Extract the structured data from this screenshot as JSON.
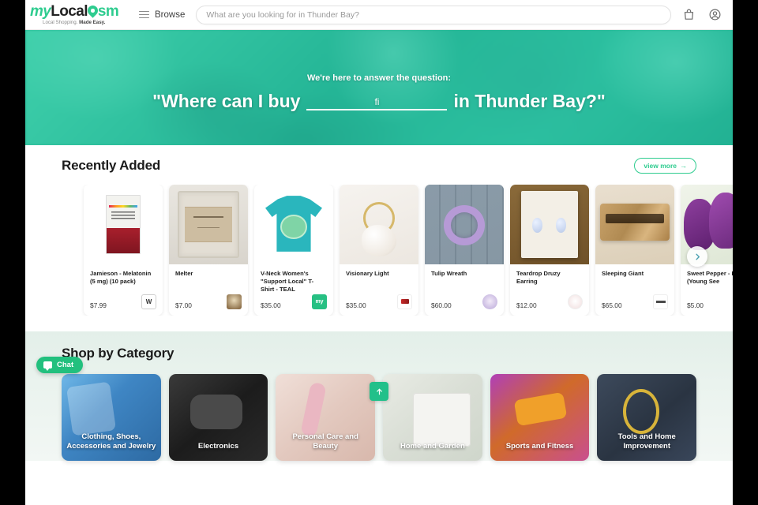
{
  "header": {
    "logo": {
      "prefix": "my",
      "main": "Local",
      "suffix": "sm",
      "pin_icon": "location-pin-icon",
      "tagline_1": "Local Shopping.",
      "tagline_2": "Made Easy."
    },
    "browse_label": "Browse",
    "menu_icon": "hamburger-menu-icon",
    "search": {
      "placeholder": "What are you looking for in Thunder Bay?",
      "value": "",
      "icon": "search-input"
    },
    "bag_icon": "shopping-bag-icon",
    "account_icon": "user-account-icon"
  },
  "hero": {
    "subtitle": "We're here to answer the question:",
    "title_before": "\"Where can I buy",
    "blank_text": "fi",
    "title_after": "in Thunder Bay?\""
  },
  "recently_added": {
    "title": "Recently Added",
    "view_more_label": "view more",
    "view_more_arrow": "→",
    "next_arrow_icon": "chevron-right-icon",
    "products": [
      {
        "name": "Jamieson - Melatonin (5 mg) (10 pack)",
        "price": "$7.99",
        "art": "art-melatonin",
        "badge": "b-wsd",
        "badge_text": "W",
        "badge_sub": "SD"
      },
      {
        "name": "Melter",
        "price": "$7.00",
        "art": "art-melter",
        "badge": "b-cat",
        "badge_text": "",
        "badge_sub": ""
      },
      {
        "name": "V-Neck Women's \"Support Local\" T-Shirt - TEAL",
        "price": "$35.00",
        "art": "art-tshirt",
        "badge": "b-my",
        "badge_text": "my",
        "badge_sub": ""
      },
      {
        "name": "Visionary Light",
        "price": "$35.00",
        "art": "art-visionary",
        "badge": "b-vis",
        "badge_text": "",
        "badge_sub": ""
      },
      {
        "name": "Tulip Wreath",
        "price": "$60.00",
        "art": "art-wreath",
        "badge": "b-tul",
        "badge_text": "",
        "badge_sub": ""
      },
      {
        "name": "Teardrop Druzy Earring",
        "price": "$12.00",
        "art": "art-druzy",
        "badge": "b-ear",
        "badge_text": "",
        "badge_sub": ""
      },
      {
        "name": "Sleeping Giant",
        "price": "$65.00",
        "art": "art-board",
        "badge": "b-slp",
        "badge_text": "",
        "badge_sub": ""
      },
      {
        "name": "Sweet Pepper - Bell (Young See",
        "price": "$5.00",
        "art": "art-pepper",
        "badge": "",
        "badge_text": "",
        "badge_sub": ""
      }
    ]
  },
  "categories": {
    "title": "Shop by Category",
    "items": [
      {
        "label": "Clothing, Shoes, Accessories and Jewelry",
        "bg": "cbg-clothing"
      },
      {
        "label": "Electronics",
        "bg": "cbg-electronics"
      },
      {
        "label": "Personal Care and Beauty",
        "bg": "cbg-personal"
      },
      {
        "label": "Home and Garden",
        "bg": "cbg-home"
      },
      {
        "label": "Sports and Fitness",
        "bg": "cbg-sports"
      },
      {
        "label": "Tools and Home Improvement",
        "bg": "cbg-tools"
      }
    ]
  },
  "floating": {
    "chat_label": "Chat",
    "chat_icon": "chat-bubble-icon",
    "scroll_top_icon": "arrow-up-icon"
  },
  "colors": {
    "brand_green": "#2ecc8f",
    "hero_teal": "#28b894",
    "chat_green": "#22c07e"
  }
}
